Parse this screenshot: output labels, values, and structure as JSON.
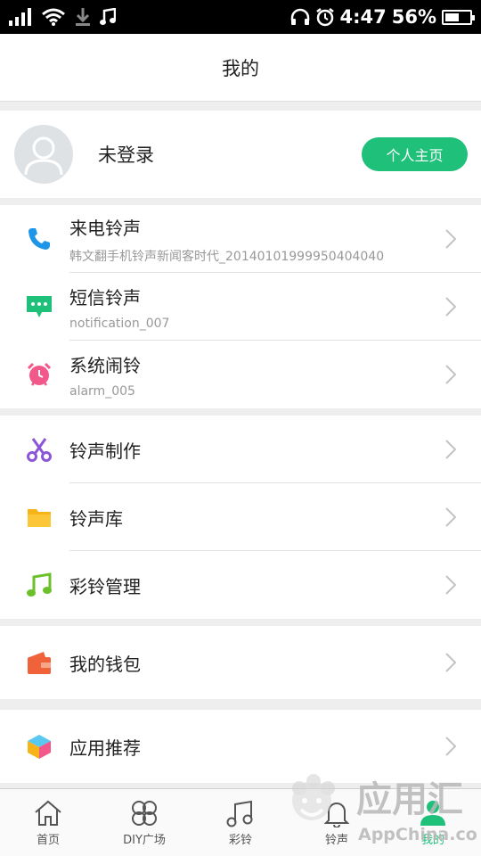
{
  "status_bar": {
    "time": "4:47",
    "battery": "56%",
    "battery_level": 0.56
  },
  "header": {
    "title": "我的"
  },
  "profile": {
    "login_status": "未登录",
    "home_button": "个人主页"
  },
  "ringtone_settings": [
    {
      "label": "来电铃声",
      "value": "韩文翻手机铃声新闻客时代_20140101999950404040",
      "icon": "phone-icon",
      "color": "#1f95e8"
    },
    {
      "label": "短信铃声",
      "value": "notification_007",
      "icon": "message-icon",
      "color": "#1fc07a"
    },
    {
      "label": "系统闹铃",
      "value": "alarm_005",
      "icon": "alarm-clock-icon",
      "color": "#f2588a"
    }
  ],
  "tools": [
    {
      "label": "铃声制作",
      "icon": "scissors-icon",
      "color": "#8b56d8"
    },
    {
      "label": "铃声库",
      "icon": "folder-icon",
      "color": "#f7b418"
    },
    {
      "label": "彩铃管理",
      "icon": "music-note-icon",
      "color": "#6cc02c"
    }
  ],
  "wallet": {
    "label": "我的钱包",
    "icon": "wallet-icon",
    "color": "#f0623a"
  },
  "apps": {
    "label": "应用推荐",
    "icon": "cube-icon"
  },
  "bottom_nav": [
    {
      "label": "首页",
      "icon": "home-icon"
    },
    {
      "label": "DIY广场",
      "icon": "diy-clover-icon"
    },
    {
      "label": "彩铃",
      "icon": "music-note-icon"
    },
    {
      "label": "铃声",
      "icon": "bell-icon"
    },
    {
      "label": "我的",
      "icon": "person-icon",
      "active": true
    }
  ],
  "watermark": {
    "name": "应用汇",
    "url": "AppChina.com"
  },
  "colors": {
    "accent": "#1fc07a",
    "divider": "#e2e2e2",
    "background": "#eeeeee"
  }
}
